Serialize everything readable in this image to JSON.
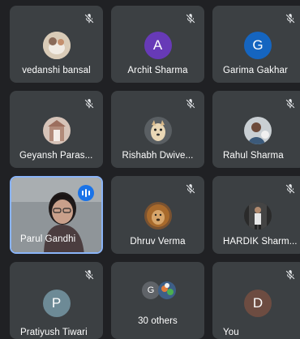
{
  "participants": [
    {
      "name": "vedanshi bansal",
      "avatar": "photo-plush-toy",
      "muted": true
    },
    {
      "name": "Archit Sharma",
      "avatar_letter": "A",
      "avatar_color": "#673ab7",
      "muted": true
    },
    {
      "name": "Garima Gakhar",
      "avatar_letter": "G",
      "avatar_color": "#1565c0",
      "muted": true
    },
    {
      "name": "Geyansh Paras...",
      "avatar": "photo-building",
      "muted": true
    },
    {
      "name": "Rishabh Dwive...",
      "avatar": "photo-dog",
      "muted": true
    },
    {
      "name": "Rahul Sharma",
      "avatar": "photo-person",
      "muted": true
    },
    {
      "name": "Parul Gandhi",
      "video": true,
      "speaking": true
    },
    {
      "name": "Dhruv Verma",
      "avatar": "photo-lion",
      "muted": true
    },
    {
      "name": "HARDIK Sharm...",
      "avatar": "photo-person-dark",
      "muted": true
    },
    {
      "name": "Pratiyush Tiwari",
      "avatar_letter": "P",
      "avatar_color": "#6d8a96",
      "muted": true
    },
    {
      "name": "30 others",
      "avatar_letter": "G",
      "avatar_color": "#5f6368",
      "group": true
    },
    {
      "name": "You",
      "avatar_letter": "D",
      "avatar_color": "#6d4c41",
      "muted": true
    }
  ],
  "icons": {
    "muted": "mic-off-icon",
    "speaking": "audio-level-icon"
  },
  "colors": {
    "background": "#202124",
    "tile": "#3c4043",
    "active_border": "#8ab4f8",
    "speaking": "#1a73e8"
  }
}
